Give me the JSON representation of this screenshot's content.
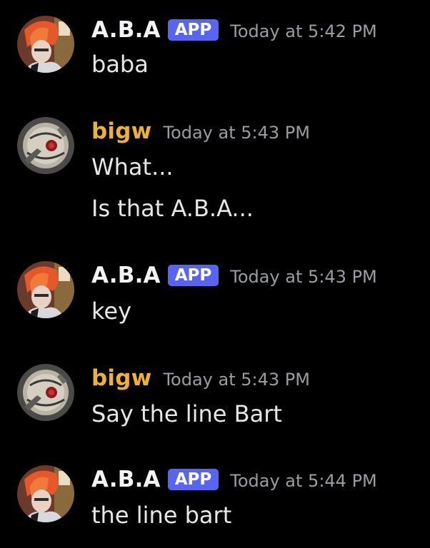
{
  "users": {
    "aba": {
      "name": "A.B.A",
      "badge": "APP",
      "name_color": "#f2f3f5"
    },
    "bigw": {
      "name": "bigw",
      "name_color": "#f0b132"
    }
  },
  "badge_color": "#5865f2",
  "messages": [
    {
      "author": "A.B.A",
      "badge": "APP",
      "time": "Today at 5:42 PM",
      "lines": [
        "baba"
      ]
    },
    {
      "author": "bigw",
      "time": "Today at 5:43 PM",
      "lines": [
        "What...",
        "Is that A.B.A..."
      ]
    },
    {
      "author": "A.B.A",
      "badge": "APP",
      "time": "Today at 5:43 PM",
      "lines": [
        "key"
      ]
    },
    {
      "author": "bigw",
      "time": "Today at 5:43 PM",
      "lines": [
        "Say the line Bart"
      ]
    },
    {
      "author": "A.B.A",
      "badge": "APP",
      "time": "Today at 5:44 PM",
      "lines": [
        "the line bart"
      ]
    }
  ]
}
